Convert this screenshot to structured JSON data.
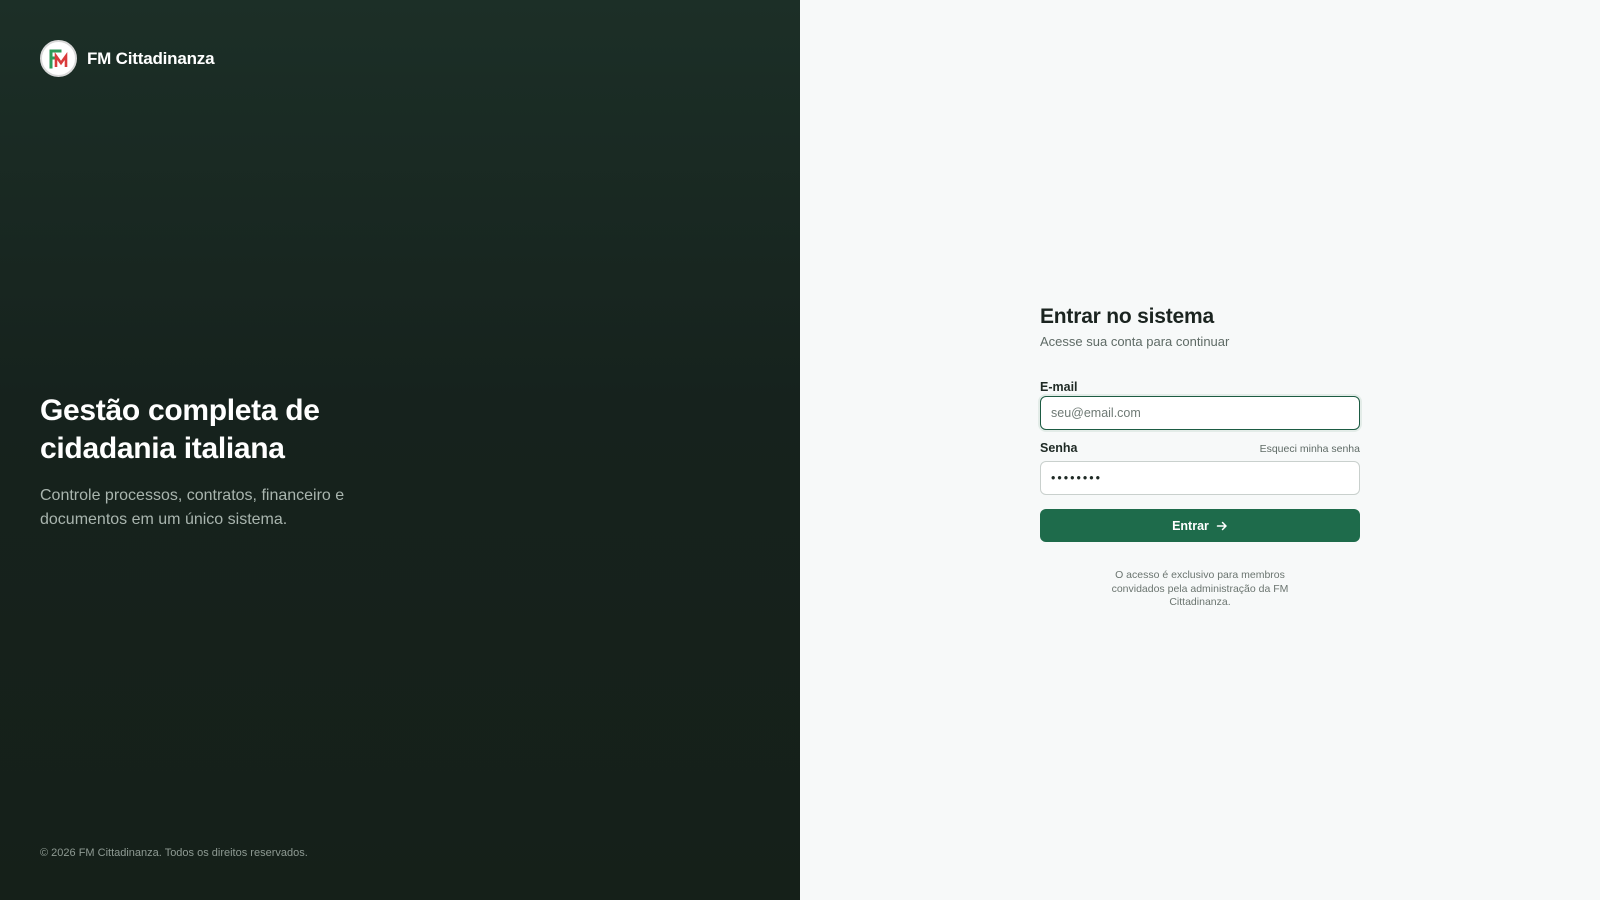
{
  "brand": {
    "name": "FM Cittadinanza",
    "logo_icon": "fm-monogram-logo",
    "logo_colors": {
      "green": "#2f9a5a",
      "red": "#d93b3b"
    }
  },
  "hero": {
    "title": "Gestão completa de cidadania italiana",
    "subtitle": "Controle processos, contratos, financeiro e documentos em um único sistema.",
    "footer": "© 2026 FM Cittadinanza. Todos os direitos reservados."
  },
  "login": {
    "title": "Entrar no sistema",
    "subtitle": "Acesse sua conta para continuar",
    "email": {
      "label": "E-mail",
      "placeholder": "seu@email.com",
      "value": ""
    },
    "password": {
      "label": "Senha",
      "forgot_label": "Esqueci minha senha",
      "value": "••••••••"
    },
    "submit_label": "Entrar",
    "submit_icon": "arrow-right-icon",
    "note": "O acesso é exclusivo para membros convidados pela administração da FM Cittadinanza."
  },
  "colors": {
    "hero_bg": "#1c2f27",
    "panel_bg": "#f7f9f9",
    "primary": "#1e6b4b",
    "focus_ring": "#1d5b43"
  }
}
